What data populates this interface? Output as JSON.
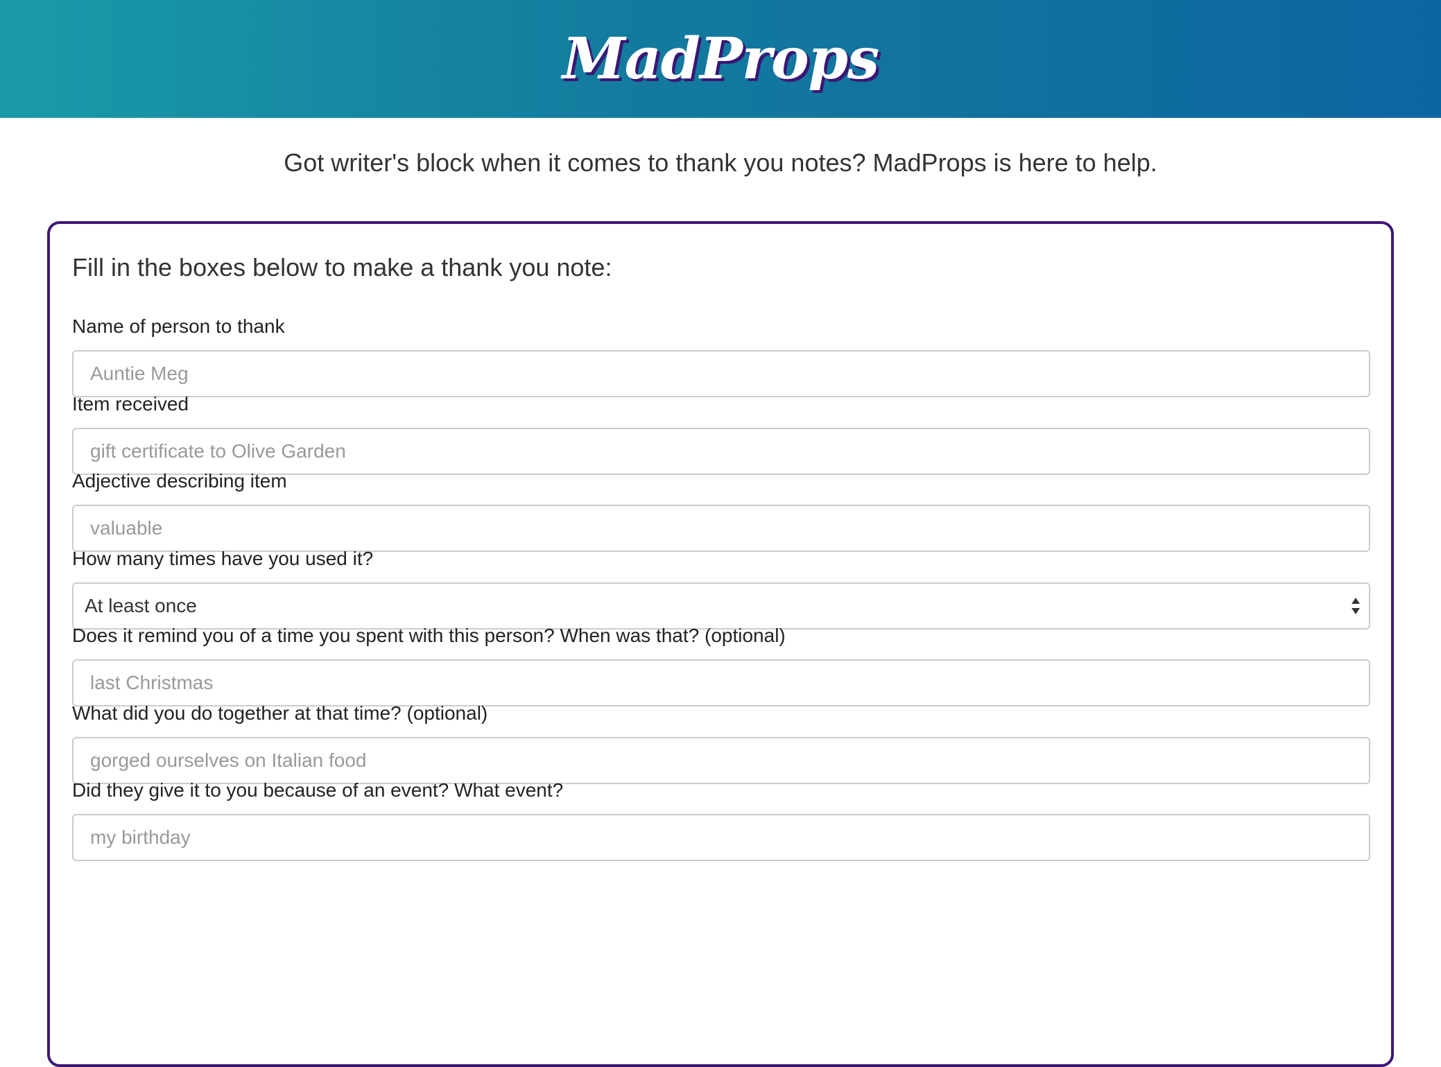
{
  "header": {
    "brand": "MadProps"
  },
  "tagline": "Got writer's block when it comes to thank you notes? MadProps is here to help.",
  "form": {
    "title": "Fill in the boxes below to make a thank you note:",
    "fields": [
      {
        "label": "Name of person to thank",
        "placeholder": "Auntie Meg",
        "value": ""
      },
      {
        "label": "Item received",
        "placeholder": "gift certificate to Olive Garden",
        "value": ""
      },
      {
        "label": "Adjective describing item",
        "placeholder": "valuable",
        "value": ""
      },
      {
        "label": "How many times have you used it?",
        "selected": "At least once"
      },
      {
        "label": "Does it remind you of a time you spent with this person? When was that? (optional)",
        "placeholder": "last Christmas",
        "value": ""
      },
      {
        "label": "What did you do together at that time? (optional)",
        "placeholder": "gorged ourselves on Italian food",
        "value": ""
      },
      {
        "label": "Did they give it to you because of an event? What event?",
        "placeholder": "my birthday",
        "value": ""
      }
    ]
  },
  "colors": {
    "header_gradient_start": "#1a9aa8",
    "header_gradient_end": "#0d65a0",
    "brand_shadow": "#3a1675",
    "card_border": "#3d1778"
  }
}
